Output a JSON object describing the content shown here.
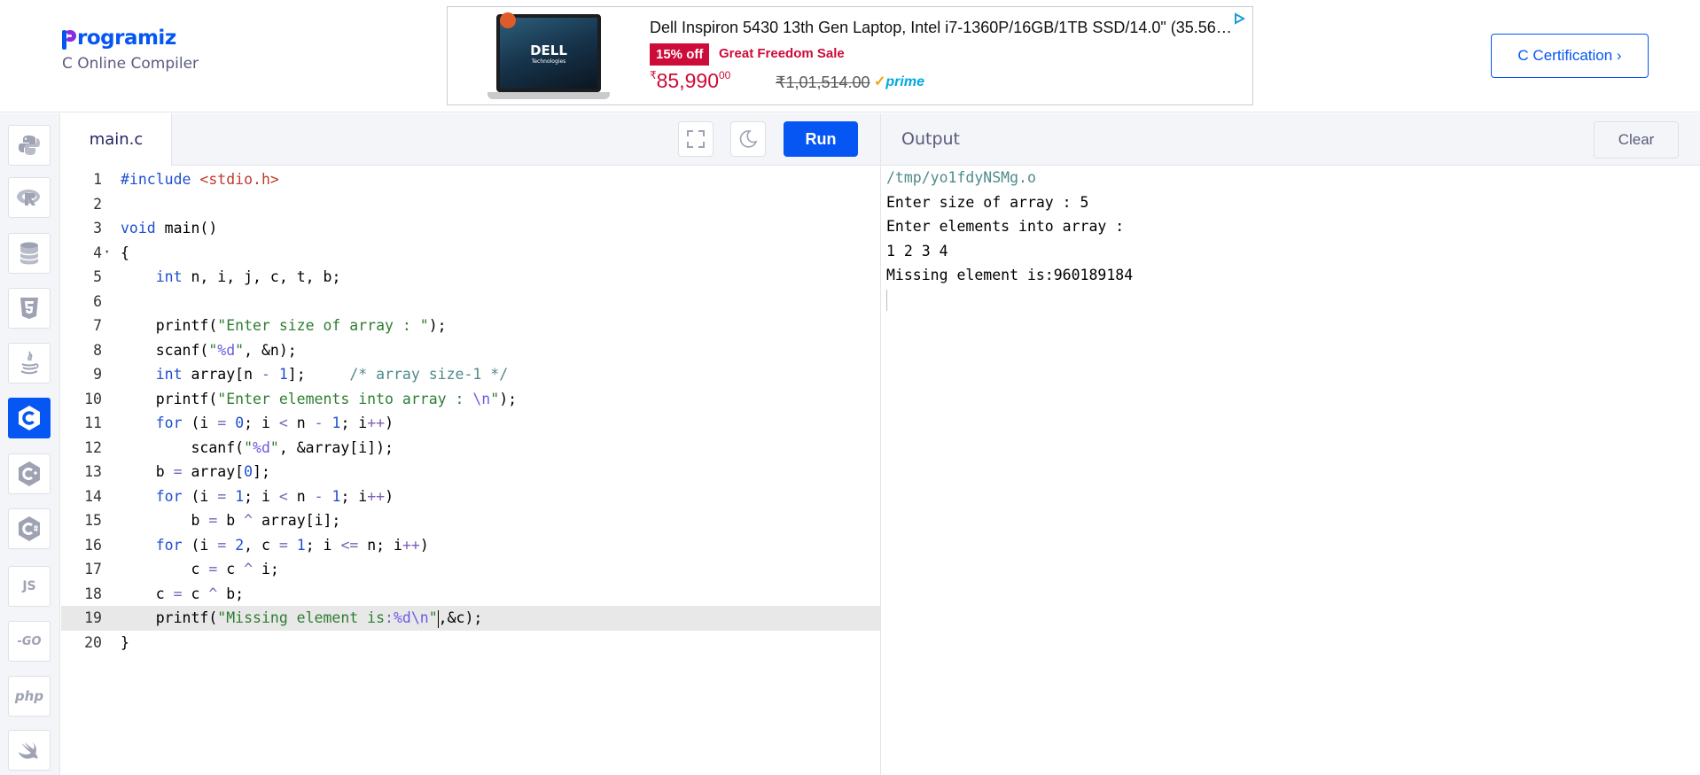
{
  "header": {
    "brand_rest": "rogramiz",
    "subtitle": "C Online Compiler",
    "cert_button": "C Certification ›"
  },
  "ad": {
    "title": "Dell Inspiron 5430 13th Gen Laptop, Intel i7-1360P/16GB/1TB SSD/14.0\" (35.56C…",
    "discount": "15% off",
    "sale": "Great Freedom Sale",
    "price_symbol": "₹",
    "price": "85,990",
    "price_paise": "00",
    "mrp": "₹1,01,514.00",
    "prime": "prime",
    "dell_logo": "DELL",
    "dell_sub": "Technologies"
  },
  "sidebar": {
    "languages": [
      {
        "name": "python",
        "active": false
      },
      {
        "name": "r",
        "active": false
      },
      {
        "name": "sql",
        "active": false
      },
      {
        "name": "html",
        "active": false
      },
      {
        "name": "java",
        "active": false
      },
      {
        "name": "c",
        "active": true
      },
      {
        "name": "cpp",
        "active": false
      },
      {
        "name": "csharp",
        "active": false
      },
      {
        "name": "js",
        "label": "JS",
        "active": false
      },
      {
        "name": "go",
        "label": "-GO",
        "active": false
      },
      {
        "name": "php",
        "label": "php",
        "active": false
      },
      {
        "name": "swift",
        "active": false
      }
    ]
  },
  "editor": {
    "filename": "main.c",
    "run_label": "Run",
    "active_line": 19
  },
  "output": {
    "title": "Output",
    "clear_label": "Clear",
    "lines": [
      "/tmp/yo1fdyNSMg.o",
      "Enter size of array : 5",
      "Enter elements into array :",
      "1 2 3 4",
      "Missing element is:960189184"
    ]
  },
  "colors": {
    "accent": "#0556f3",
    "brand_purple": "#8a2be2",
    "ad_red": "#cc0c39"
  }
}
